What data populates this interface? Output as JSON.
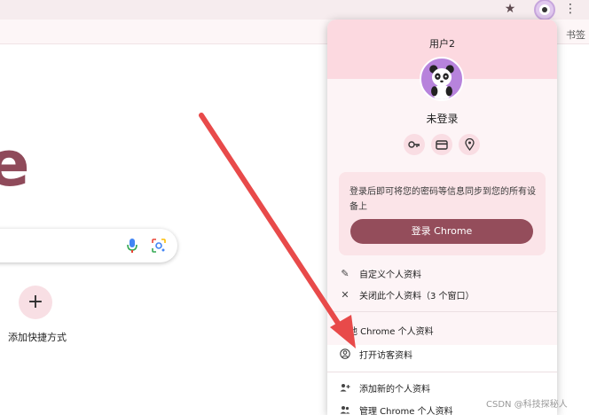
{
  "browser": {
    "bookmarks_label": "书签",
    "star_icon": "star-icon",
    "menu_icon": "vertical-dots-icon"
  },
  "newtab": {
    "logo_fragment": "e",
    "shortcut_add_symbol": "+",
    "shortcut_label": "添加快捷方式"
  },
  "profile_menu": {
    "user_name": "用户2",
    "status": "未登录",
    "quick_actions": [
      "key-icon",
      "card-icon",
      "location-pin-icon"
    ],
    "sync_message": "登录后即可将您的密码等信息同步到您的所有设备上",
    "signin_button": "登录 Chrome",
    "items": [
      {
        "label": "自定义个人资料",
        "icon": "pencil-icon"
      },
      {
        "label": "关闭此个人资料（3 个窗口）",
        "icon": "close-icon"
      },
      {
        "label": "他 Chrome 个人资料",
        "icon": ""
      },
      {
        "label": "打开访客资料",
        "icon": "guest-icon"
      },
      {
        "label": "添加新的个人资料",
        "icon": "add-person-icon"
      },
      {
        "label": "管理 Chrome 个人资料",
        "icon": "people-icon"
      }
    ]
  },
  "watermark": "CSDN @科技探秘人",
  "colors": {
    "accent": "#944d5b",
    "header_bg": "#fcd9e0",
    "arrow": "#e84a4a",
    "avatar_bg": "#b783dc"
  }
}
